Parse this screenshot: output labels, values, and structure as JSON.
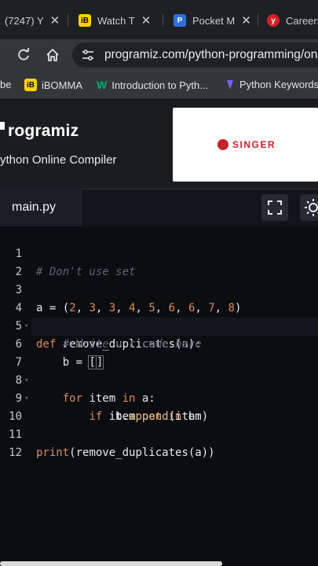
{
  "browser": {
    "tabs": [
      {
        "label": "(7247) Y",
        "icon": "youtube-icon"
      },
      {
        "label": "Watch T",
        "icon": "ibomma-icon"
      },
      {
        "label": "Pocket M",
        "icon": "pocket-icon"
      },
      {
        "label": "Careers",
        "icon": "careers-icon"
      }
    ],
    "url": "programiz.com/python-programming/onli",
    "bookmarks": [
      {
        "label": "be"
      },
      {
        "label": "iBOMMA",
        "icon": "ibomma-icon"
      },
      {
        "label": "Introduction to Pyth...",
        "icon": "w3-icon"
      },
      {
        "label": "Python Keywords",
        "icon": "programiz-icon"
      }
    ]
  },
  "site": {
    "logo": "rogramiz",
    "subtitle": "ython Online Compiler",
    "ad_brand": "SINGER"
  },
  "editor": {
    "file_tab": "main.py",
    "lines": [
      {
        "n": "1",
        "text": "# Don't use set"
      },
      {
        "n": "2",
        "text": ""
      },
      {
        "n": "3",
        "text": "a = (2, 3, 3, 4, 5, 6, 6, 7, 8)"
      },
      {
        "n": "4",
        "text": "def remove_duplicates(a):"
      },
      {
        "n": "5",
        "text": "    # Write u r code here"
      },
      {
        "n": "6",
        "text": "    b = []"
      },
      {
        "n": "7",
        "text": "    for item in a:"
      },
      {
        "n": "8",
        "text": "        if item not in b:"
      },
      {
        "n": "9",
        "text": "            b.append(item)"
      },
      {
        "n": "10",
        "text": ""
      },
      {
        "n": "11",
        "text": "print(remove_duplicates(a))"
      },
      {
        "n": "12",
        "text": ""
      }
    ]
  },
  "colors": {
    "accent_red": "#c8202d",
    "keyword": "#e0885a",
    "comment": "#5c6370"
  }
}
